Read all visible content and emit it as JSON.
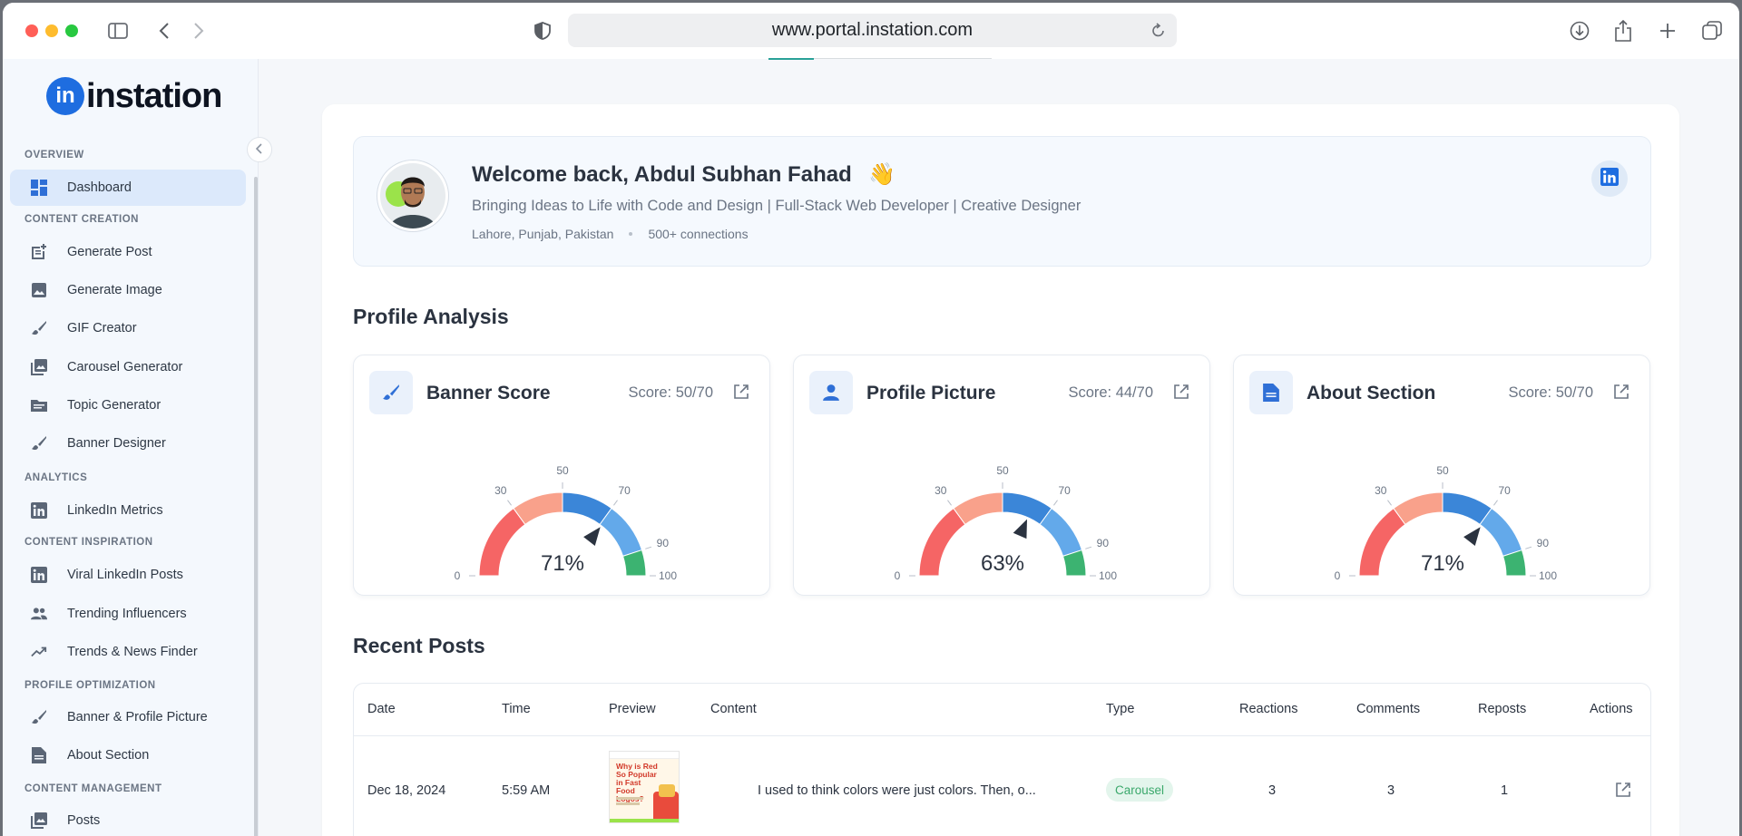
{
  "browser": {
    "url": "www.portal.instation.com"
  },
  "brand": {
    "logo_badge": "in",
    "logo_text": "instation",
    "accent": "#2f6fd6"
  },
  "sidebar": {
    "collapse_icon": "chevron-left-icon",
    "sections": [
      {
        "label": "OVERVIEW",
        "items": [
          {
            "label": "Dashboard",
            "icon": "dashboard-icon",
            "active": true
          }
        ]
      },
      {
        "label": "CONTENT CREATION",
        "items": [
          {
            "label": "Generate Post",
            "icon": "post-add-icon"
          },
          {
            "label": "Generate Image",
            "icon": "image-icon"
          },
          {
            "label": "GIF Creator",
            "icon": "brush-icon"
          },
          {
            "label": "Carousel Generator",
            "icon": "collections-icon"
          },
          {
            "label": "Topic Generator",
            "icon": "folder-icon"
          },
          {
            "label": "Banner Designer",
            "icon": "brush-icon"
          }
        ]
      },
      {
        "label": "ANALYTICS",
        "items": [
          {
            "label": "LinkedIn Metrics",
            "icon": "linkedin-icon"
          }
        ]
      },
      {
        "label": "CONTENT INSPIRATION",
        "items": [
          {
            "label": "Viral LinkedIn Posts",
            "icon": "linkedin-icon"
          },
          {
            "label": "Trending Influencers",
            "icon": "people-icon"
          },
          {
            "label": "Trends & News Finder",
            "icon": "trending-up-icon"
          }
        ]
      },
      {
        "label": "PROFILE OPTIMIZATION",
        "items": [
          {
            "label": "Banner & Profile Picture",
            "icon": "brush-icon"
          },
          {
            "label": "About Section",
            "icon": "document-icon"
          }
        ]
      },
      {
        "label": "CONTENT MANAGEMENT",
        "items": [
          {
            "label": "Posts",
            "icon": "collections-icon"
          }
        ]
      }
    ]
  },
  "welcome": {
    "title": "Welcome back, Abdul Subhan Fahad",
    "emoji": "👋",
    "headline": "Bringing Ideas to Life with Code and Design | Full-Stack Web Developer | Creative Designer",
    "location": "Lahore, Punjab, Pakistan",
    "connections": "500+ connections"
  },
  "profile_analysis": {
    "title": "Profile Analysis",
    "cards": [
      {
        "title": "Banner Score",
        "score": "Score: 50/70",
        "value_label": "71%",
        "value": 71,
        "icon": "brush-icon"
      },
      {
        "title": "Profile Picture",
        "score": "Score: 44/70",
        "value_label": "63%",
        "value": 63,
        "icon": "person-icon"
      },
      {
        "title": "About Section",
        "score": "Score: 50/70",
        "value_label": "71%",
        "value": 71,
        "icon": "document-icon"
      }
    ],
    "gauge_ticks": [
      "0",
      "30",
      "50",
      "70",
      "90",
      "100"
    ],
    "gauge_colors": {
      "low": "#f56565",
      "mid_low": "#f9a18b",
      "mid": "#3b86d8",
      "mid_high": "#63a9ea",
      "high": "#3cb371",
      "needle": "#2b3340"
    }
  },
  "recent_posts": {
    "title": "Recent Posts",
    "columns": [
      "Date",
      "Time",
      "Preview",
      "Content",
      "Type",
      "Reactions",
      "Comments",
      "Reposts",
      "Actions"
    ],
    "rows": [
      {
        "date": "Dec 18, 2024",
        "time": "5:59 AM",
        "preview_text": "Why is Red So Popular in Fast Food Logos?",
        "content": "I used to think colors were just colors. Then, o...",
        "type": "Carousel",
        "reactions": "3",
        "comments": "3",
        "reposts": "1"
      }
    ]
  }
}
